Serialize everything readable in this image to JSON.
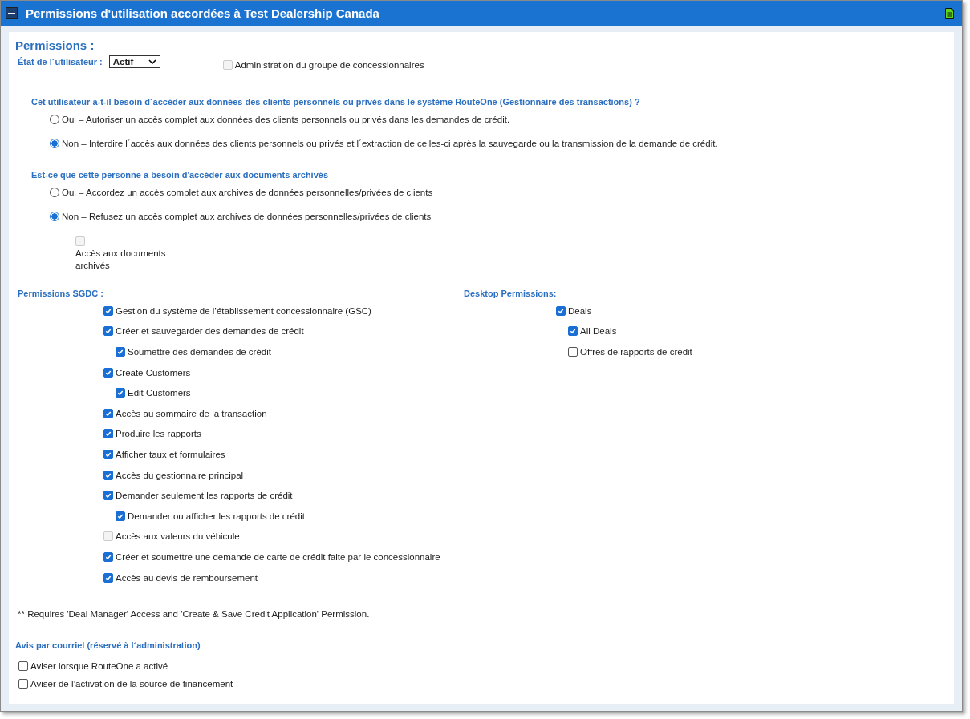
{
  "window": {
    "title": "Permissions d'utilisation accordées à Test Dealership Canada",
    "expanded": true
  },
  "heading": "Permissions :",
  "user_status": {
    "label": "État de l´utilisateur :",
    "value": "Actif"
  },
  "group_admin": {
    "label": "Administration du groupe de concessionnaires",
    "checked": false,
    "disabled": true
  },
  "questions": [
    {
      "title": "Cet utilisateur a-t-il besoin d´accéder aux données des clients personnels ou privés dans le système RouteOne (Gestionnaire des transactions) ?",
      "options": [
        {
          "label": "Oui – Autoriser un accès complet aux données des clients personnels ou privés dans les demandes de crédit.",
          "selected": false
        },
        {
          "label": "Non – Interdire l´accès aux données des clients personnels ou privés et l´extraction de celles-ci après la sauvegarde ou la transmission de la demande de crédit.",
          "selected": true
        }
      ]
    },
    {
      "title": "Est-ce que cette personne a besoin d'accéder aux documents archivés",
      "options": [
        {
          "label": "Oui – Accordez un accès complet aux archives de données personnelles/privées de clients",
          "selected": false
        },
        {
          "label": "Non – Refusez un accès complet aux archives de données personnelles/privées de clients",
          "selected": true
        }
      ]
    }
  ],
  "archive_access": {
    "label": "Accès aux documents archivés",
    "checked": false,
    "disabled": true
  },
  "sgdc": {
    "title": "Permissions SGDC :",
    "items": [
      {
        "label": "Gestion du système de l’établissement concessionnaire (GSC)",
        "checked": true,
        "disabled": false
      },
      {
        "label": "Créer et sauvegarder des demandes de crédit",
        "checked": true,
        "disabled": false,
        "children": [
          {
            "label": "Soumettre des demandes de crédit",
            "checked": true,
            "disabled": false
          }
        ]
      },
      {
        "label": "Create Customers",
        "checked": true,
        "disabled": false,
        "children": [
          {
            "label": "Edit Customers",
            "checked": true,
            "disabled": false
          }
        ]
      },
      {
        "label": "Accès au sommaire de la transaction",
        "checked": true,
        "disabled": false
      },
      {
        "label": "Produire les rapports",
        "checked": true,
        "disabled": false
      },
      {
        "label": "Afficher taux et formulaires",
        "checked": true,
        "disabled": false
      },
      {
        "label": "Accès du gestionnaire principal",
        "checked": true,
        "disabled": false
      },
      {
        "label": "Demander seulement les rapports de crédit",
        "checked": true,
        "disabled": false,
        "children": [
          {
            "label": "Demander ou afficher les rapports de crédit",
            "checked": true,
            "disabled": false
          }
        ]
      },
      {
        "label": "Accès aux valeurs du véhicule",
        "checked": false,
        "disabled": true
      },
      {
        "label": "Créer et soumettre une demande de carte de crédit faite par le concessionnaire",
        "checked": true,
        "disabled": false
      },
      {
        "label": "Accès au devis de remboursement",
        "checked": true,
        "disabled": false
      }
    ]
  },
  "desktop": {
    "title": "Desktop Permissions:",
    "items": [
      {
        "label": "Deals",
        "checked": true,
        "disabled": false,
        "children": [
          {
            "label": "All Deals",
            "checked": true,
            "disabled": false
          },
          {
            "label": "Offres de rapports de crédit",
            "checked": false,
            "disabled": false
          }
        ]
      }
    ]
  },
  "footnote": "** Requires 'Deal Manager' Access and 'Create & Save Credit Application' Permission.",
  "email": {
    "title": "Avis par courriel (réservé à l´administration)",
    "colon": ":",
    "items": [
      {
        "label": "Aviser lorsque RouteOne a activé",
        "checked": false,
        "disabled": false
      },
      {
        "label": "Aviser de l’activation de la source de financement",
        "checked": false,
        "disabled": false
      }
    ]
  }
}
